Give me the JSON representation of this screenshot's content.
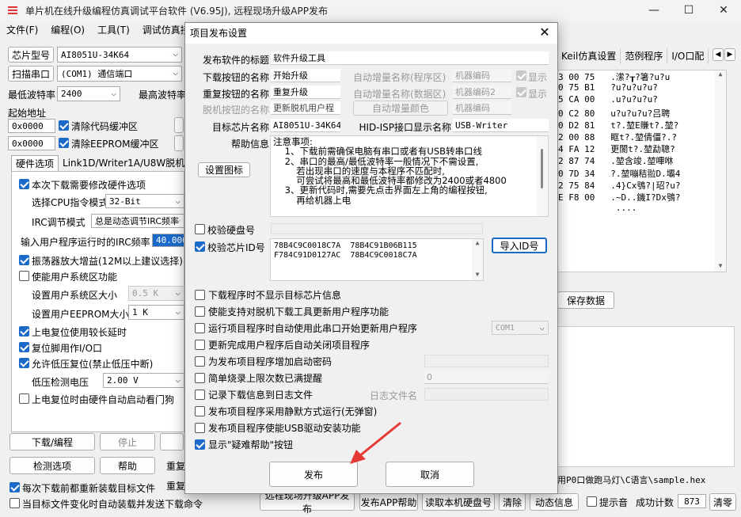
{
  "window": {
    "title": "单片机在线升级编程仿真调试平台软件 (V6.95J), 远程现场升级APP发布",
    "minimize": "—",
    "maximize": "☐",
    "close": "✕"
  },
  "menu": [
    "文件(F)",
    "编程(O)",
    "工具(T)",
    "调试仿真接口"
  ],
  "left": {
    "chip_type_label": "芯片型号",
    "chip_type_value": "AI8051U-34K64",
    "scan_port_label": "扫描串口",
    "port_value": "(COM1) 通信端口",
    "min_baud_label": "最低波特率",
    "min_baud_value": "2400",
    "max_baud_label": "最高波特率",
    "start_addr_label": "起始地址",
    "addr1": "0x0000",
    "clear_code_label": "清除代码缓冲区",
    "addr2": "0x0000",
    "clear_eeprom_label": "清除EEPROM缓冲区",
    "tabs": [
      "硬件选项",
      "Link1D/Writer1A/U8W脱机",
      "程"
    ],
    "options": {
      "modify_hw": "本次下载需要修改硬件选项",
      "cpu_mode_label": "选择CPU指令模式",
      "cpu_mode_value": "32-Bit",
      "irc_mode_label": "IRC调节模式",
      "irc_mode_value": "总是动态调节IRC频率",
      "irc_freq_label": "输入用户程序运行时的IRC频率",
      "irc_freq_value": "40.000",
      "osc_gain": "振荡器放大增益(12M以上建议选择)",
      "user_sys_area": "使能用户系统区功能",
      "sys_area_size_label": "设置用户系统区大小",
      "sys_area_size_value": "0.5 K",
      "eeprom_size_label": "设置用户EEPROM大小",
      "eeprom_size_value": "1   K",
      "power_delay": "上电复位使用较长延时",
      "reset_io": "复位脚用作I/O口",
      "low_volt_reset": "允许低压复位(禁止低压中断)",
      "low_volt_label": "低压检测电压",
      "low_volt_value": "2.00 V",
      "watchdog": "上电复位时由硬件自动启动看门狗"
    },
    "download_btn": "下载/编程",
    "stop_btn": "停止",
    "check_btn": "检测选项",
    "help_btn": "帮助",
    "reload_chk": "每次下载前都重新装载目标文件",
    "auto_load_chk": "当目标文件变化时自动装载并发送下载命令",
    "re1": "重复",
    "re2": "重复"
  },
  "right": {
    "tabs": [
      "Keil仿真设置",
      "范例程序",
      "I/O口配"
    ],
    "hex_rows": [
      "3 00 75   .潆?┰?箸?u?u",
      "0 75 B1   ?u?u?u?u?",
      "5 CA 00   .u?u?u?u?",
      "0 C2 80   u?u?u?u?吕聘",
      "0 D2 81   t?.堃E賺t?.堃?",
      "2 00 88   眶t?.堃倩僵?.?",
      "4 FA 12   更閬t?.堃勐聰?",
      "2 87 74   .堃含竣.堃嗶咻",
      "0 7D 34   ?.堃嘣秸翋D.壩4",
      "2 75 84   .4}Cx鴞?|玿?u?",
      "E F8 00   .~D..鐖I?Dx鴞?",
      "           ...."
    ],
    "save_btn": "保存数据",
    "path": "用P0口做跑马灯\\C语言\\sample.hex"
  },
  "bottom": {
    "remote_btn": "远程现场升级APP发布",
    "publish_help_btn": "发布APP帮助",
    "read_disk_btn": "读取本机硬盘号",
    "clear_btn": "清除",
    "dynamic_btn": "动态信息",
    "sound_chk": "提示音",
    "success_label": "成功计数",
    "success_count": "873",
    "clear_count_btn": "清零"
  },
  "dialog": {
    "title": "项目发布设置",
    "close": "✕",
    "release_title_label": "发布软件的标题",
    "release_title_value": "软件升级工具",
    "download_btn_name_label": "下载按钮的名称",
    "download_btn_name_value": "开始升级",
    "auto_inc_prog_label": "自动增量名称(程序区)",
    "machine_code1": "机器编码",
    "display1": "显示",
    "repeat_btn_name_label": "重复按钮的名称",
    "repeat_btn_name_value": "重复升级",
    "auto_inc_data_label": "自动增量名称(数据区)",
    "machine_code2": "机器编码2",
    "display2": "显示",
    "offline_btn_name_label": "脱机按钮的名称",
    "offline_btn_name_value": "更新脱机用户程",
    "auto_inc_color_btn": "自动增量颜色",
    "machine_code3": "机器编码",
    "target_chip_label": "目标芯片名称",
    "target_chip_value": "AI8051U-34K64",
    "hid_name_label": "HID-ISP接口显示名称",
    "hid_name_value": "USB-Writer",
    "help_info_label": "帮助信息",
    "set_icon_btn": "设置图标",
    "help_lines": [
      "注意事项:",
      "    1、下载前需确保电脑有串口或者有USB转串口线",
      "    2、串口的最高/最低波特率一般情况下不需设置,",
      "        若出现串口的速度与本程序不匹配时,",
      "        可尝试将最高和最低波特率都修改为2400或者4800",
      "    3、更新代码时,需要先点击界面左上角的编程按钮,",
      "        再给机器上电"
    ],
    "verify_disk_label": "校验硬盘号",
    "verify_chip_label": "校验芯片ID号",
    "chip_ids": [
      "78B4C9C0018C7A  78B4C91B06B115",
      "F784C91D0127AC  78B4C9C0018C7A"
    ],
    "import_id_btn": "导入ID号",
    "options": [
      "下载程序时不显示目标芯片信息",
      "使能支持对脱机下载工具更新用户程序功能",
      "运行项目程序时自动使用此串口开始更新用户程序",
      "更新完成用户程序后自动关闭项目程序",
      "为发布项目程序增加启动密码",
      "简单烧录上限次数已满提醒",
      "记录下载信息到日志文件",
      "发布项目程序采用静默方式运行(无弹窗)",
      "发布项目程序使能USB驱动安装功能",
      "显示\"疑难帮助\"按钮"
    ],
    "com_value": "COM1",
    "limit_value": "0",
    "log_file_label": "日志文件名",
    "publish_btn": "发布",
    "cancel_btn": "取消"
  }
}
